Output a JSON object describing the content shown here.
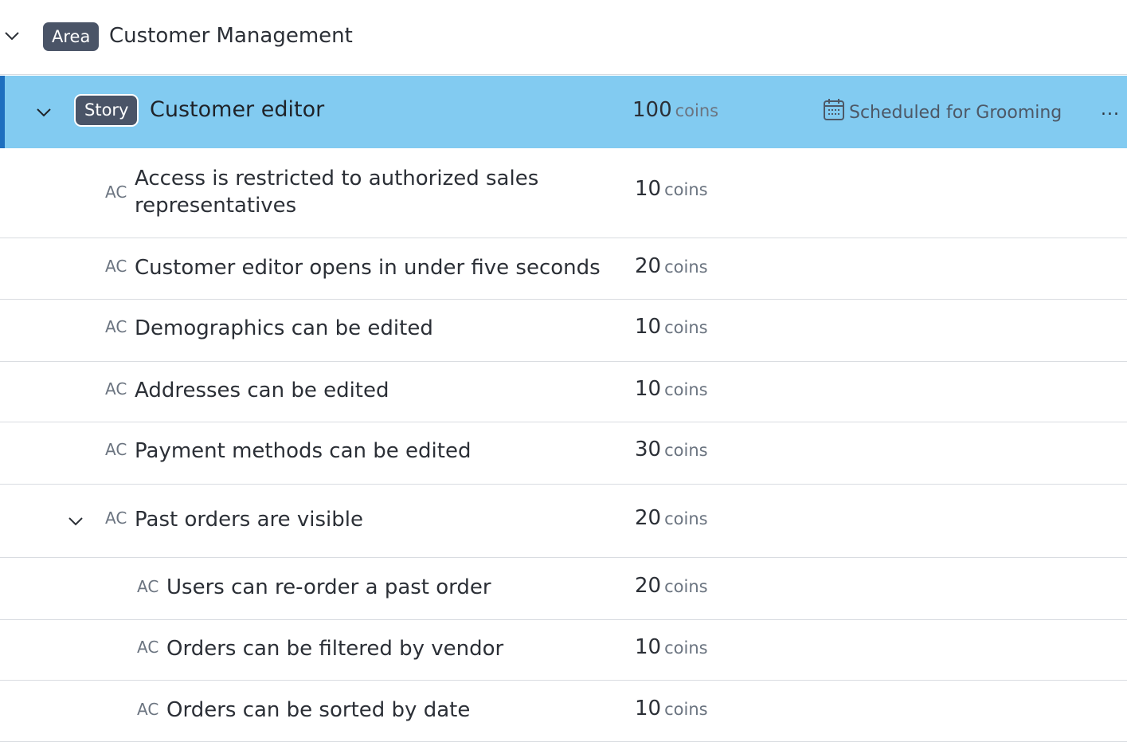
{
  "area": {
    "badge": "Area",
    "title": "Customer Management"
  },
  "story": {
    "badge": "Story",
    "title": "Customer editor",
    "coins_value": "100",
    "coins_unit": "coins",
    "status_icon": "calendar-icon",
    "status": "Scheduled for Grooming",
    "more": "...",
    "accent_color": "#82cbf1"
  },
  "criteria": [
    {
      "tag": "AC",
      "text": "Access is restricted to authorized sales representatives",
      "coins_value": "10",
      "coins_unit": "coins",
      "depth": 1
    },
    {
      "tag": "AC",
      "text": "Customer editor opens in under five seconds",
      "coins_value": "20",
      "coins_unit": "coins",
      "depth": 1
    },
    {
      "tag": "AC",
      "text": "Demographics can be edited",
      "coins_value": "10",
      "coins_unit": "coins",
      "depth": 1
    },
    {
      "tag": "AC",
      "text": "Addresses can be edited",
      "coins_value": "10",
      "coins_unit": "coins",
      "depth": 1
    },
    {
      "tag": "AC",
      "text": "Payment methods can be edited",
      "coins_value": "30",
      "coins_unit": "coins",
      "depth": 1
    },
    {
      "tag": "AC",
      "text": "Past orders are visible",
      "coins_value": "20",
      "coins_unit": "coins",
      "depth": 1,
      "expanded": true
    },
    {
      "tag": "AC",
      "text": "Users can re-order a past order",
      "coins_value": "20",
      "coins_unit": "coins",
      "depth": 2
    },
    {
      "tag": "AC",
      "text": "Orders can be filtered by vendor",
      "coins_value": "10",
      "coins_unit": "coins",
      "depth": 2
    },
    {
      "tag": "AC",
      "text": "Orders can be sorted by date",
      "coins_value": "10",
      "coins_unit": "coins",
      "depth": 2
    }
  ]
}
